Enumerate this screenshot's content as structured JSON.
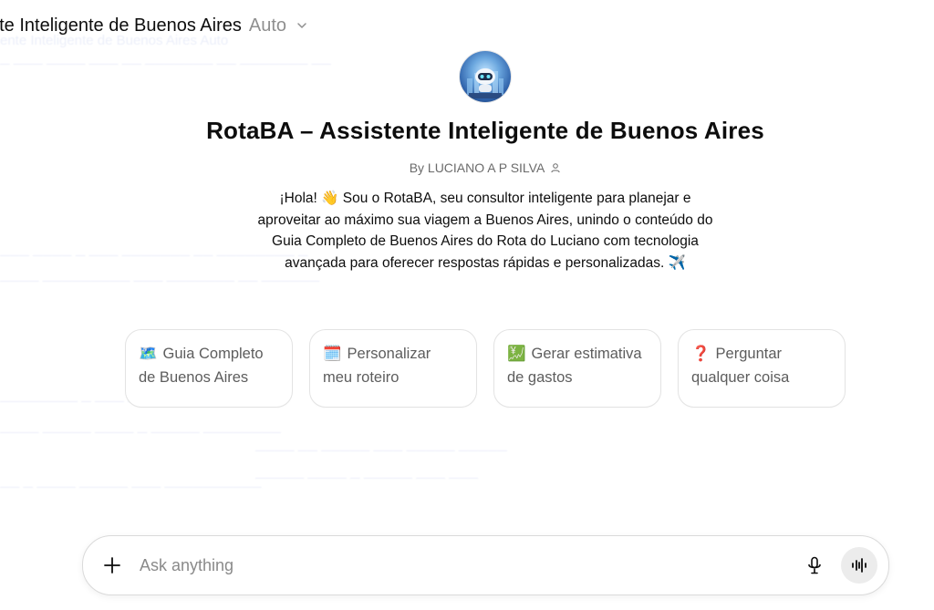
{
  "header": {
    "title": "nte Inteligente de Buenos Aires",
    "model_label": "Auto",
    "model_chevron_icon": "chevron-down-icon"
  },
  "gpt": {
    "avatar_icon": "robot-avatar-icon",
    "name": "RotaBA – Assistente Inteligente de Buenos Aires",
    "byline": "By LUCIANO A P SILVA",
    "byline_icon": "person-icon",
    "description": "¡Hola! 👋 Sou o RotaBA, seu consultor inteligente para planejar e aproveitar ao máximo sua viagem a Buenos Aires, unindo o conteúdo do Guia Completo de Buenos Aires do Rota do Luciano com tecnologia avançada para oferecer respostas rápidas e personalizadas. ✈️"
  },
  "starters": [
    {
      "emoji": "🗺️",
      "label": "Guia Completo de Buenos Aires"
    },
    {
      "emoji": "🗓️",
      "label": "Personalizar meu roteiro"
    },
    {
      "emoji": "💹",
      "label": "Gerar estimativa de gastos"
    },
    {
      "emoji": "❓",
      "label": "Perguntar qualquer coisa"
    }
  ],
  "composer": {
    "placeholder": "Ask anything",
    "plus_icon": "plus-icon",
    "mic_icon": "microphone-icon",
    "voice_icon": "voice-mode-icon"
  }
}
